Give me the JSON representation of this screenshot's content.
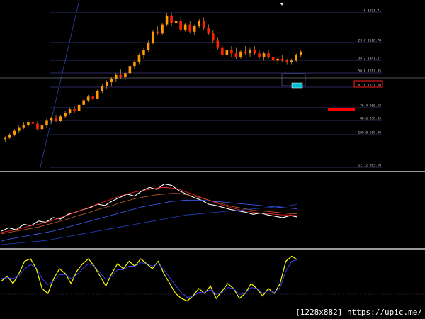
{
  "chart_data": [
    {
      "type": "candlestick",
      "panel": "price",
      "series": [
        {
          "values": [
            [
              0.55,
              0.58,
              0.52,
              0.57
            ],
            [
              0.57,
              0.62,
              0.55,
              0.6
            ],
            [
              0.6,
              0.66,
              0.58,
              0.64
            ],
            [
              0.64,
              0.7,
              0.62,
              0.68
            ],
            [
              0.68,
              0.74,
              0.66,
              0.7
            ],
            [
              0.7,
              0.76,
              0.68,
              0.74
            ],
            [
              0.74,
              0.77,
              0.7,
              0.72
            ],
            [
              0.72,
              0.75,
              0.64,
              0.66
            ],
            [
              0.66,
              0.72,
              0.6,
              0.7
            ],
            [
              0.7,
              0.78,
              0.68,
              0.76
            ],
            [
              0.76,
              0.8,
              0.72,
              0.78
            ],
            [
              0.78,
              0.82,
              0.74,
              0.75
            ],
            [
              0.75,
              0.82,
              0.74,
              0.8
            ],
            [
              0.8,
              0.86,
              0.78,
              0.84
            ],
            [
              0.84,
              0.9,
              0.82,
              0.88
            ],
            [
              0.88,
              0.92,
              0.84,
              0.86
            ],
            [
              0.86,
              0.95,
              0.85,
              0.93
            ],
            [
              0.93,
              1.0,
              0.92,
              0.98
            ],
            [
              0.98,
              1.04,
              0.96,
              1.02
            ],
            [
              1.02,
              1.06,
              0.98,
              1.0
            ],
            [
              1.0,
              1.1,
              0.99,
              1.08
            ],
            [
              1.08,
              1.16,
              1.06,
              1.14
            ],
            [
              1.14,
              1.2,
              1.1,
              1.18
            ],
            [
              1.18,
              1.24,
              1.14,
              1.22
            ],
            [
              1.22,
              1.28,
              1.18,
              1.26
            ],
            [
              1.26,
              1.32,
              1.22,
              1.24
            ],
            [
              1.24,
              1.3,
              1.2,
              1.28
            ],
            [
              1.28,
              1.38,
              1.26,
              1.36
            ],
            [
              1.36,
              1.42,
              1.32,
              1.4
            ],
            [
              1.4,
              1.5,
              1.38,
              1.48
            ],
            [
              1.48,
              1.56,
              1.44,
              1.54
            ],
            [
              1.54,
              1.64,
              1.52,
              1.62
            ],
            [
              1.62,
              1.76,
              1.6,
              1.74
            ],
            [
              1.74,
              1.8,
              1.7,
              1.72
            ],
            [
              1.72,
              1.84,
              1.7,
              1.82
            ],
            [
              1.82,
              1.95,
              1.8,
              1.92
            ],
            [
              1.92,
              1.95,
              1.8,
              1.84
            ],
            [
              1.84,
              1.9,
              1.78,
              1.86
            ],
            [
              1.86,
              1.9,
              1.74,
              1.76
            ],
            [
              1.76,
              1.84,
              1.74,
              1.82
            ],
            [
              1.82,
              1.86,
              1.72,
              1.74
            ],
            [
              1.74,
              1.82,
              1.7,
              1.8
            ],
            [
              1.8,
              1.88,
              1.78,
              1.86
            ],
            [
              1.86,
              1.9,
              1.76,
              1.78
            ],
            [
              1.78,
              1.82,
              1.7,
              1.72
            ],
            [
              1.72,
              1.76,
              1.62,
              1.64
            ],
            [
              1.64,
              1.68,
              1.54,
              1.56
            ],
            [
              1.56,
              1.6,
              1.46,
              1.48
            ],
            [
              1.48,
              1.56,
              1.44,
              1.54
            ],
            [
              1.54,
              1.58,
              1.46,
              1.5
            ],
            [
              1.5,
              1.56,
              1.44,
              1.46
            ],
            [
              1.46,
              1.54,
              1.44,
              1.52
            ],
            [
              1.52,
              1.58,
              1.48,
              1.5
            ],
            [
              1.5,
              1.56,
              1.46,
              1.54
            ],
            [
              1.54,
              1.58,
              1.48,
              1.5
            ],
            [
              1.5,
              1.54,
              1.44,
              1.46
            ],
            [
              1.46,
              1.52,
              1.42,
              1.5
            ],
            [
              1.5,
              1.54,
              1.44,
              1.46
            ],
            [
              1.46,
              1.5,
              1.4,
              1.42
            ],
            [
              1.42,
              1.46,
              1.38,
              1.44
            ],
            [
              1.44,
              1.48,
              1.4,
              1.42
            ],
            [
              1.42,
              1.44,
              1.38,
              1.4
            ],
            [
              1.4,
              1.44,
              1.38,
              1.42
            ],
            [
              1.42,
              1.5,
              1.4,
              1.48
            ],
            [
              1.48,
              1.54,
              1.46,
              1.52
            ]
          ]
        }
      ],
      "fib_levels": [
        {
          "label": "0  1931.71"
        },
        {
          "label": "23.6  1628.78"
        },
        {
          "label": "38.2  1441.17"
        },
        {
          "label": "50.0  1287.85"
        },
        {
          "label": "61.8  1137.10"
        },
        {
          "label": "76.4  960.58"
        },
        {
          "label": "88.6  838.33"
        },
        {
          "label": "100.0  689.90"
        },
        {
          "label": "127.2  365.20"
        }
      ],
      "colors": {
        "bull": "#ff9900",
        "bear": "#ff2200",
        "wick": "#ffb040",
        "fib_line": "#5858c8",
        "highlight_box": "#ff2020",
        "marker": "#ff0000"
      }
    },
    {
      "type": "line",
      "panel": "moving-averages",
      "series": [
        {
          "color": "#ffffff",
          "values": [
            0.2,
            0.25,
            0.22,
            0.3,
            0.28,
            0.35,
            0.33,
            0.4,
            0.38,
            0.45,
            0.48,
            0.52,
            0.55,
            0.6,
            0.58,
            0.65,
            0.7,
            0.75,
            0.72,
            0.8,
            0.85,
            0.82,
            0.9,
            0.88,
            0.8,
            0.75,
            0.7,
            0.66,
            0.6,
            0.58,
            0.55,
            0.52,
            0.5,
            0.48,
            0.45,
            0.47,
            0.44,
            0.42,
            0.4,
            0.43,
            0.41
          ]
        },
        {
          "color": "#ff2020",
          "values": [
            0.18,
            0.2,
            0.22,
            0.25,
            0.28,
            0.3,
            0.33,
            0.36,
            0.4,
            0.44,
            0.48,
            0.52,
            0.56,
            0.6,
            0.64,
            0.68,
            0.72,
            0.75,
            0.78,
            0.8,
            0.82,
            0.84,
            0.85,
            0.84,
            0.82,
            0.78,
            0.74,
            0.7,
            0.66,
            0.62,
            0.58,
            0.55,
            0.52,
            0.5,
            0.48,
            0.47,
            0.46,
            0.45,
            0.44,
            0.44,
            0.43
          ]
        },
        {
          "color": "#c06020",
          "values": [
            0.16,
            0.18,
            0.2,
            0.22,
            0.24,
            0.26,
            0.29,
            0.32,
            0.35,
            0.38,
            0.42,
            0.45,
            0.48,
            0.52,
            0.55,
            0.58,
            0.62,
            0.65,
            0.68,
            0.7,
            0.72,
            0.74,
            0.75,
            0.76,
            0.76,
            0.74,
            0.72,
            0.69,
            0.66,
            0.63,
            0.6,
            0.57,
            0.55,
            0.53,
            0.51,
            0.5,
            0.49,
            0.48,
            0.47,
            0.46,
            0.46
          ]
        },
        {
          "color": "#4060ff",
          "values": [
            0.05,
            0.08,
            0.1,
            0.12,
            0.14,
            0.16,
            0.18,
            0.2,
            0.23,
            0.26,
            0.29,
            0.32,
            0.35,
            0.38,
            0.41,
            0.44,
            0.47,
            0.5,
            0.53,
            0.56,
            0.58,
            0.6,
            0.62,
            0.64,
            0.65,
            0.66,
            0.66,
            0.66,
            0.65,
            0.64,
            0.63,
            0.62,
            0.61,
            0.6,
            0.59,
            0.58,
            0.57,
            0.56,
            0.55,
            0.54,
            0.53
          ]
        },
        {
          "color": "#2040c0",
          "values": [
            0.0,
            0.01,
            0.02,
            0.03,
            0.04,
            0.05,
            0.06,
            0.08,
            0.1,
            0.12,
            0.14,
            0.16,
            0.18,
            0.2,
            0.22,
            0.24,
            0.26,
            0.28,
            0.3,
            0.32,
            0.34,
            0.36,
            0.38,
            0.4,
            0.42,
            0.44,
            0.45,
            0.46,
            0.47,
            0.48,
            0.49,
            0.5,
            0.51,
            0.52,
            0.53,
            0.54,
            0.55,
            0.56,
            0.57,
            0.58,
            0.6
          ]
        }
      ]
    },
    {
      "type": "line",
      "panel": "oscillator",
      "series": [
        {
          "color": "#ffff00",
          "values": [
            0.45,
            0.55,
            0.4,
            0.6,
            0.85,
            0.9,
            0.7,
            0.3,
            0.2,
            0.5,
            0.7,
            0.6,
            0.4,
            0.65,
            0.8,
            0.9,
            0.75,
            0.55,
            0.35,
            0.6,
            0.8,
            0.7,
            0.85,
            0.75,
            0.9,
            0.8,
            0.7,
            0.85,
            0.6,
            0.4,
            0.2,
            0.1,
            0.05,
            0.15,
            0.3,
            0.2,
            0.35,
            0.1,
            0.25,
            0.4,
            0.3,
            0.1,
            0.2,
            0.4,
            0.3,
            0.15,
            0.3,
            0.2,
            0.4,
            0.85,
            0.95,
            0.88
          ]
        },
        {
          "color": "#4040ff",
          "values": [
            0.5,
            0.52,
            0.5,
            0.55,
            0.7,
            0.78,
            0.72,
            0.5,
            0.38,
            0.45,
            0.58,
            0.58,
            0.5,
            0.58,
            0.7,
            0.8,
            0.75,
            0.62,
            0.48,
            0.55,
            0.68,
            0.68,
            0.75,
            0.75,
            0.82,
            0.8,
            0.75,
            0.8,
            0.68,
            0.52,
            0.36,
            0.22,
            0.12,
            0.14,
            0.22,
            0.22,
            0.28,
            0.18,
            0.22,
            0.32,
            0.3,
            0.18,
            0.2,
            0.32,
            0.3,
            0.2,
            0.26,
            0.22,
            0.32,
            0.65,
            0.85,
            0.88
          ]
        }
      ]
    }
  ],
  "watermark": "[1228x882] https://upic.me/",
  "colors": {
    "background": "#000000",
    "separator": "#cccccc",
    "grid": "#303030"
  }
}
